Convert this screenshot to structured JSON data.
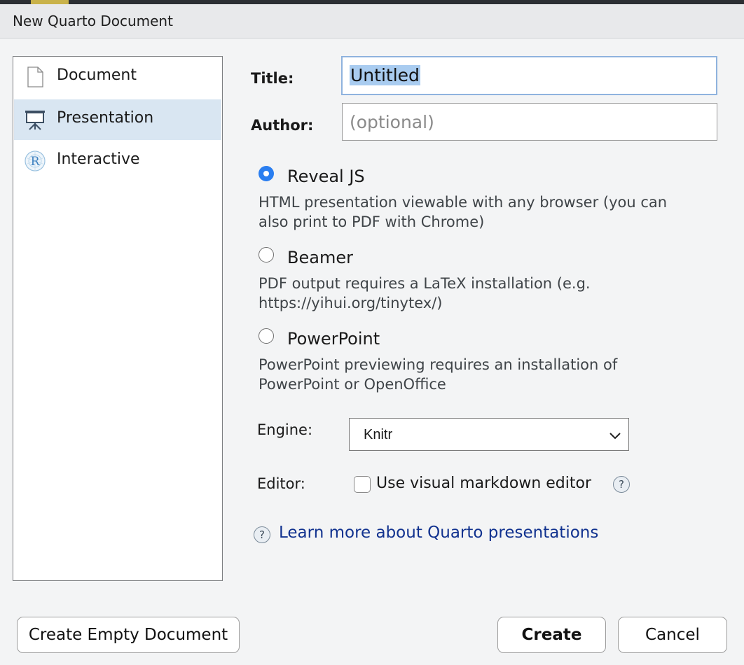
{
  "window": {
    "title": "New Quarto Document"
  },
  "sidebar": {
    "items": [
      {
        "label": "Document",
        "icon": "document-icon",
        "selected": false
      },
      {
        "label": "Presentation",
        "icon": "presentation-icon",
        "selected": true
      },
      {
        "label": "Interactive",
        "icon": "r-logo-icon",
        "selected": false
      }
    ]
  },
  "form": {
    "title_label": "Title:",
    "title_value": "Untitled",
    "author_label": "Author:",
    "author_placeholder": "(optional)"
  },
  "formats": [
    {
      "label": "Reveal JS",
      "desc1": "HTML presentation viewable with any browser (you can",
      "desc2": "also print to PDF with Chrome)",
      "selected": true
    },
    {
      "label": "Beamer",
      "desc1": "PDF output requires a LaTeX installation (e.g.",
      "desc2": "https://yihui.org/tinytex/)",
      "selected": false
    },
    {
      "label": "PowerPoint",
      "desc1": "PowerPoint previewing requires an installation of",
      "desc2": "PowerPoint or OpenOffice",
      "selected": false
    }
  ],
  "engine": {
    "label": "Engine:",
    "value": "Knitr"
  },
  "editor": {
    "label": "Editor:",
    "checkbox_label": "Use visual markdown editor",
    "checked": false
  },
  "help": {
    "glyph": "?",
    "link_text": "Learn more about Quarto presentations"
  },
  "buttons": {
    "create_empty": "Create Empty Document",
    "create": "Create",
    "cancel": "Cancel"
  },
  "colors": {
    "accent": "#2a7ef0",
    "selection": "#d9e6f2",
    "link": "#11328f"
  }
}
